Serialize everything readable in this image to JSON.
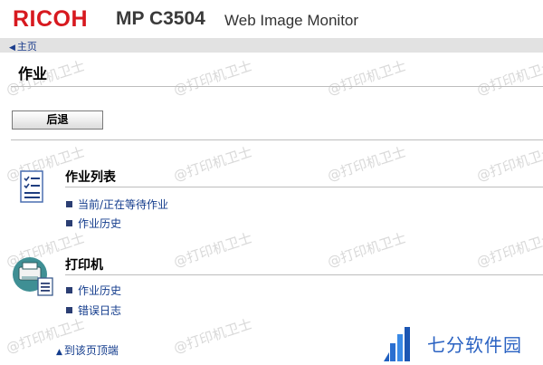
{
  "header": {
    "brand": "RICOH",
    "model": "MP C3504",
    "subtitle": "Web Image Monitor"
  },
  "nav": {
    "home": "主页"
  },
  "page": {
    "title": "作业",
    "back_label": "后退"
  },
  "sections": [
    {
      "title": "作业列表",
      "icon": "job-list-icon",
      "links": [
        "当前/正在等待作业",
        "作业历史"
      ]
    },
    {
      "title": "打印机",
      "icon": "printer-icon",
      "links": [
        "作业历史",
        "错误日志"
      ]
    }
  ],
  "footer": {
    "top_link": "到该页顶端"
  },
  "watermark": {
    "text": "@打印机卫士"
  },
  "badge": {
    "text": "七分软件园",
    "icon": "bar-chart-logo"
  },
  "colors": {
    "brand_red": "#d7191f",
    "link_blue": "#123b8c",
    "nav_bg": "#e2e2e2"
  }
}
